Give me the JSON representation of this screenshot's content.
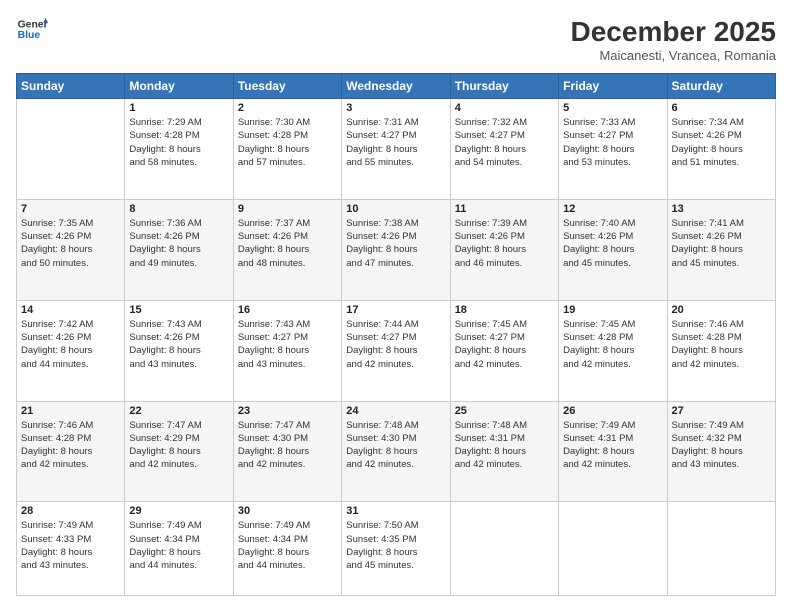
{
  "header": {
    "logo_line1": "General",
    "logo_line2": "Blue",
    "month": "December 2025",
    "location": "Maicanesti, Vrancea, Romania"
  },
  "weekdays": [
    "Sunday",
    "Monday",
    "Tuesday",
    "Wednesday",
    "Thursday",
    "Friday",
    "Saturday"
  ],
  "weeks": [
    [
      {
        "day": "",
        "info": ""
      },
      {
        "day": "1",
        "info": "Sunrise: 7:29 AM\nSunset: 4:28 PM\nDaylight: 8 hours\nand 58 minutes."
      },
      {
        "day": "2",
        "info": "Sunrise: 7:30 AM\nSunset: 4:28 PM\nDaylight: 8 hours\nand 57 minutes."
      },
      {
        "day": "3",
        "info": "Sunrise: 7:31 AM\nSunset: 4:27 PM\nDaylight: 8 hours\nand 55 minutes."
      },
      {
        "day": "4",
        "info": "Sunrise: 7:32 AM\nSunset: 4:27 PM\nDaylight: 8 hours\nand 54 minutes."
      },
      {
        "day": "5",
        "info": "Sunrise: 7:33 AM\nSunset: 4:27 PM\nDaylight: 8 hours\nand 53 minutes."
      },
      {
        "day": "6",
        "info": "Sunrise: 7:34 AM\nSunset: 4:26 PM\nDaylight: 8 hours\nand 51 minutes."
      }
    ],
    [
      {
        "day": "7",
        "info": "Sunrise: 7:35 AM\nSunset: 4:26 PM\nDaylight: 8 hours\nand 50 minutes."
      },
      {
        "day": "8",
        "info": "Sunrise: 7:36 AM\nSunset: 4:26 PM\nDaylight: 8 hours\nand 49 minutes."
      },
      {
        "day": "9",
        "info": "Sunrise: 7:37 AM\nSunset: 4:26 PM\nDaylight: 8 hours\nand 48 minutes."
      },
      {
        "day": "10",
        "info": "Sunrise: 7:38 AM\nSunset: 4:26 PM\nDaylight: 8 hours\nand 47 minutes."
      },
      {
        "day": "11",
        "info": "Sunrise: 7:39 AM\nSunset: 4:26 PM\nDaylight: 8 hours\nand 46 minutes."
      },
      {
        "day": "12",
        "info": "Sunrise: 7:40 AM\nSunset: 4:26 PM\nDaylight: 8 hours\nand 45 minutes."
      },
      {
        "day": "13",
        "info": "Sunrise: 7:41 AM\nSunset: 4:26 PM\nDaylight: 8 hours\nand 45 minutes."
      }
    ],
    [
      {
        "day": "14",
        "info": "Sunrise: 7:42 AM\nSunset: 4:26 PM\nDaylight: 8 hours\nand 44 minutes."
      },
      {
        "day": "15",
        "info": "Sunrise: 7:43 AM\nSunset: 4:26 PM\nDaylight: 8 hours\nand 43 minutes."
      },
      {
        "day": "16",
        "info": "Sunrise: 7:43 AM\nSunset: 4:27 PM\nDaylight: 8 hours\nand 43 minutes."
      },
      {
        "day": "17",
        "info": "Sunrise: 7:44 AM\nSunset: 4:27 PM\nDaylight: 8 hours\nand 42 minutes."
      },
      {
        "day": "18",
        "info": "Sunrise: 7:45 AM\nSunset: 4:27 PM\nDaylight: 8 hours\nand 42 minutes."
      },
      {
        "day": "19",
        "info": "Sunrise: 7:45 AM\nSunset: 4:28 PM\nDaylight: 8 hours\nand 42 minutes."
      },
      {
        "day": "20",
        "info": "Sunrise: 7:46 AM\nSunset: 4:28 PM\nDaylight: 8 hours\nand 42 minutes."
      }
    ],
    [
      {
        "day": "21",
        "info": "Sunrise: 7:46 AM\nSunset: 4:28 PM\nDaylight: 8 hours\nand 42 minutes."
      },
      {
        "day": "22",
        "info": "Sunrise: 7:47 AM\nSunset: 4:29 PM\nDaylight: 8 hours\nand 42 minutes."
      },
      {
        "day": "23",
        "info": "Sunrise: 7:47 AM\nSunset: 4:30 PM\nDaylight: 8 hours\nand 42 minutes."
      },
      {
        "day": "24",
        "info": "Sunrise: 7:48 AM\nSunset: 4:30 PM\nDaylight: 8 hours\nand 42 minutes."
      },
      {
        "day": "25",
        "info": "Sunrise: 7:48 AM\nSunset: 4:31 PM\nDaylight: 8 hours\nand 42 minutes."
      },
      {
        "day": "26",
        "info": "Sunrise: 7:49 AM\nSunset: 4:31 PM\nDaylight: 8 hours\nand 42 minutes."
      },
      {
        "day": "27",
        "info": "Sunrise: 7:49 AM\nSunset: 4:32 PM\nDaylight: 8 hours\nand 43 minutes."
      }
    ],
    [
      {
        "day": "28",
        "info": "Sunrise: 7:49 AM\nSunset: 4:33 PM\nDaylight: 8 hours\nand 43 minutes."
      },
      {
        "day": "29",
        "info": "Sunrise: 7:49 AM\nSunset: 4:34 PM\nDaylight: 8 hours\nand 44 minutes."
      },
      {
        "day": "30",
        "info": "Sunrise: 7:49 AM\nSunset: 4:34 PM\nDaylight: 8 hours\nand 44 minutes."
      },
      {
        "day": "31",
        "info": "Sunrise: 7:50 AM\nSunset: 4:35 PM\nDaylight: 8 hours\nand 45 minutes."
      },
      {
        "day": "",
        "info": ""
      },
      {
        "day": "",
        "info": ""
      },
      {
        "day": "",
        "info": ""
      }
    ]
  ]
}
